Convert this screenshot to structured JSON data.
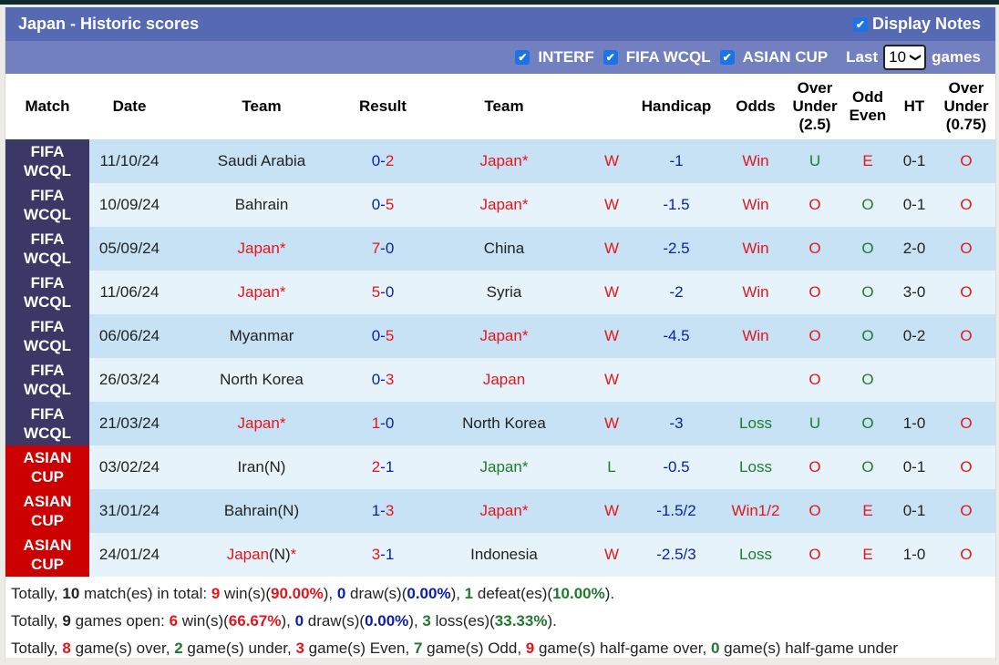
{
  "header": {
    "title": "Japan - Historic scores",
    "display_notes_label": "Display Notes",
    "display_notes_checked": true
  },
  "filters": {
    "items": [
      {
        "label": "INTERF",
        "checked": true
      },
      {
        "label": "FIFA WCQL",
        "checked": true
      },
      {
        "label": "ASIAN CUP",
        "checked": true
      }
    ],
    "last_label": "Last",
    "games_select_value": "10",
    "games_label": "games"
  },
  "columns": [
    "Match",
    "Date",
    "Team",
    "Result",
    "Team",
    "",
    "Handicap",
    "Odds",
    "Over Under (2.5)",
    "Odd Even",
    "HT",
    "Over Under (0.75)"
  ],
  "column_lines": {
    "ou25": [
      "Over",
      "Under",
      "(2.5)"
    ],
    "oe": [
      "Odd",
      "Even"
    ],
    "ou075": [
      "Over",
      "Under",
      "(0.75)"
    ]
  },
  "colors": {
    "title_bar": "#5669b3",
    "filter_bar": "#7380c0",
    "wcql_badge": "#3b3766",
    "asian_badge": "#cc0000",
    "row_dark": "#c7e2f5",
    "row_light": "#e6f3fb",
    "red": "#e8141b",
    "blue": "#0a1fa6",
    "green": "#1f7a2e"
  },
  "rows": [
    {
      "match": [
        "FIFA",
        "WCQL"
      ],
      "type": "wcql",
      "date": "11/10/24",
      "home": "Saudi Arabia",
      "home_color": "black",
      "home_suffix": "",
      "home_star": "",
      "hs": "0",
      "hs_color": "blue",
      "as": "2",
      "as_color": "red",
      "away": "Japan",
      "away_color": "red",
      "away_suffix": "",
      "away_star": "*",
      "wl": "W",
      "wl_color": "red",
      "handicap": "-1",
      "odds": "Win",
      "odds_color": "red",
      "ou": "U",
      "ou_color": "green",
      "oe": "E",
      "oe_color": "red",
      "ht": "0-1",
      "ou075": "O",
      "ou075_color": "red"
    },
    {
      "match": [
        "FIFA",
        "WCQL"
      ],
      "type": "wcql",
      "date": "10/09/24",
      "home": "Bahrain",
      "home_color": "black",
      "home_suffix": "",
      "home_star": "",
      "hs": "0",
      "hs_color": "blue",
      "as": "5",
      "as_color": "red",
      "away": "Japan",
      "away_color": "red",
      "away_suffix": "",
      "away_star": "*",
      "wl": "W",
      "wl_color": "red",
      "handicap": "-1.5",
      "odds": "Win",
      "odds_color": "red",
      "ou": "O",
      "ou_color": "red",
      "oe": "O",
      "oe_color": "green",
      "ht": "0-1",
      "ou075": "O",
      "ou075_color": "red"
    },
    {
      "match": [
        "FIFA",
        "WCQL"
      ],
      "type": "wcql",
      "date": "05/09/24",
      "home": "Japan",
      "home_color": "red",
      "home_suffix": "",
      "home_star": "*",
      "hs": "7",
      "hs_color": "red",
      "as": "0",
      "as_color": "blue",
      "away": "China",
      "away_color": "black",
      "away_suffix": "",
      "away_star": "",
      "wl": "W",
      "wl_color": "red",
      "handicap": "-2.5",
      "odds": "Win",
      "odds_color": "red",
      "ou": "O",
      "ou_color": "red",
      "oe": "O",
      "oe_color": "green",
      "ht": "2-0",
      "ou075": "O",
      "ou075_color": "red"
    },
    {
      "match": [
        "FIFA",
        "WCQL"
      ],
      "type": "wcql",
      "date": "11/06/24",
      "home": "Japan",
      "home_color": "red",
      "home_suffix": "",
      "home_star": "*",
      "hs": "5",
      "hs_color": "red",
      "as": "0",
      "as_color": "blue",
      "away": "Syria",
      "away_color": "black",
      "away_suffix": "",
      "away_star": "",
      "wl": "W",
      "wl_color": "red",
      "handicap": "-2",
      "odds": "Win",
      "odds_color": "red",
      "ou": "O",
      "ou_color": "red",
      "oe": "O",
      "oe_color": "green",
      "ht": "3-0",
      "ou075": "O",
      "ou075_color": "red"
    },
    {
      "match": [
        "FIFA",
        "WCQL"
      ],
      "type": "wcql",
      "date": "06/06/24",
      "home": "Myanmar",
      "home_color": "black",
      "home_suffix": "",
      "home_star": "",
      "hs": "0",
      "hs_color": "blue",
      "as": "5",
      "as_color": "red",
      "away": "Japan",
      "away_color": "red",
      "away_suffix": "",
      "away_star": "*",
      "wl": "W",
      "wl_color": "red",
      "handicap": "-4.5",
      "odds": "Win",
      "odds_color": "red",
      "ou": "O",
      "ou_color": "red",
      "oe": "O",
      "oe_color": "green",
      "ht": "0-2",
      "ou075": "O",
      "ou075_color": "red"
    },
    {
      "match": [
        "FIFA",
        "WCQL"
      ],
      "type": "wcql",
      "date": "26/03/24",
      "home": "North Korea",
      "home_color": "black",
      "home_suffix": "",
      "home_star": "",
      "hs": "0",
      "hs_color": "blue",
      "as": "3",
      "as_color": "red",
      "away": "Japan",
      "away_color": "red",
      "away_suffix": "",
      "away_star": "",
      "wl": "W",
      "wl_color": "red",
      "handicap": "",
      "odds": "",
      "odds_color": "red",
      "ou": "O",
      "ou_color": "red",
      "oe": "O",
      "oe_color": "green",
      "ht": "",
      "ou075": "",
      "ou075_color": "red"
    },
    {
      "match": [
        "FIFA",
        "WCQL"
      ],
      "type": "wcql",
      "date": "21/03/24",
      "home": "Japan",
      "home_color": "red",
      "home_suffix": "",
      "home_star": "*",
      "hs": "1",
      "hs_color": "red",
      "as": "0",
      "as_color": "blue",
      "away": "North Korea",
      "away_color": "black",
      "away_suffix": "",
      "away_star": "",
      "wl": "W",
      "wl_color": "red",
      "handicap": "-3",
      "odds": "Loss",
      "odds_color": "green",
      "ou": "U",
      "ou_color": "green",
      "oe": "O",
      "oe_color": "green",
      "ht": "1-0",
      "ou075": "O",
      "ou075_color": "red"
    },
    {
      "match": [
        "ASIAN",
        "CUP"
      ],
      "type": "asian",
      "date": "03/02/24",
      "home": "Iran",
      "home_color": "black",
      "home_suffix": "(N)",
      "home_star": "",
      "hs": "2",
      "hs_color": "red",
      "as": "1",
      "as_color": "blue",
      "away": "Japan",
      "away_color": "green",
      "away_suffix": "",
      "away_star": "*",
      "wl": "L",
      "wl_color": "green",
      "handicap": "-0.5",
      "odds": "Loss",
      "odds_color": "green",
      "ou": "O",
      "ou_color": "red",
      "oe": "O",
      "oe_color": "green",
      "ht": "0-1",
      "ou075": "O",
      "ou075_color": "red"
    },
    {
      "match": [
        "ASIAN",
        "CUP"
      ],
      "type": "asian",
      "date": "31/01/24",
      "home": "Bahrain",
      "home_color": "black",
      "home_suffix": "(N)",
      "home_star": "",
      "hs": "1",
      "hs_color": "blue",
      "as": "3",
      "as_color": "red",
      "away": "Japan",
      "away_color": "red",
      "away_suffix": "",
      "away_star": "*",
      "wl": "W",
      "wl_color": "red",
      "handicap": "-1.5/2",
      "odds": "Win1/2",
      "odds_color": "red",
      "ou": "O",
      "ou_color": "red",
      "oe": "E",
      "oe_color": "red",
      "ht": "0-1",
      "ou075": "O",
      "ou075_color": "red"
    },
    {
      "match": [
        "ASIAN",
        "CUP"
      ],
      "type": "asian",
      "date": "24/01/24",
      "home": "Japan",
      "home_color": "red",
      "home_suffix": "(N)",
      "home_star": "*",
      "hs": "3",
      "hs_color": "red",
      "as": "1",
      "as_color": "blue",
      "away": "Indonesia",
      "away_color": "black",
      "away_suffix": "",
      "away_star": "",
      "wl": "W",
      "wl_color": "red",
      "handicap": "-2.5/3",
      "odds": "Loss",
      "odds_color": "green",
      "ou": "O",
      "ou_color": "red",
      "oe": "E",
      "oe_color": "red",
      "ht": "1-0",
      "ou075": "O",
      "ou075_color": "red"
    }
  ],
  "summary": {
    "line1": [
      {
        "t": "Totally, "
      },
      {
        "t": "10",
        "c": "black",
        "b": true
      },
      {
        "t": " match(es) in total: "
      },
      {
        "t": "9",
        "c": "red",
        "b": true
      },
      {
        "t": " win(s)("
      },
      {
        "t": "90.00%",
        "c": "red",
        "b": true
      },
      {
        "t": "), "
      },
      {
        "t": "0",
        "c": "blue",
        "b": true
      },
      {
        "t": " draw(s)("
      },
      {
        "t": "0.00%",
        "c": "blue",
        "b": true
      },
      {
        "t": "), "
      },
      {
        "t": "1",
        "c": "green",
        "b": true
      },
      {
        "t": " defeat(es)("
      },
      {
        "t": "10.00%",
        "c": "green",
        "b": true
      },
      {
        "t": ")."
      }
    ],
    "line2": [
      {
        "t": "Totally, "
      },
      {
        "t": "9",
        "c": "black",
        "b": true
      },
      {
        "t": " games open: "
      },
      {
        "t": "6",
        "c": "red",
        "b": true
      },
      {
        "t": " win(s)("
      },
      {
        "t": "66.67%",
        "c": "red",
        "b": true
      },
      {
        "t": "), "
      },
      {
        "t": "0",
        "c": "blue",
        "b": true
      },
      {
        "t": " draw(s)("
      },
      {
        "t": "0.00%",
        "c": "blue",
        "b": true
      },
      {
        "t": "), "
      },
      {
        "t": "3",
        "c": "green",
        "b": true
      },
      {
        "t": " loss(es)("
      },
      {
        "t": "33.33%",
        "c": "green",
        "b": true
      },
      {
        "t": ")."
      }
    ],
    "line3": [
      {
        "t": "Totally, "
      },
      {
        "t": "8",
        "c": "red",
        "b": true
      },
      {
        "t": " game(s) over, "
      },
      {
        "t": "2",
        "c": "green",
        "b": true
      },
      {
        "t": " game(s) under, "
      },
      {
        "t": "3",
        "c": "red",
        "b": true
      },
      {
        "t": " game(s) Even, "
      },
      {
        "t": "7",
        "c": "green",
        "b": true
      },
      {
        "t": " game(s) Odd, "
      },
      {
        "t": "9",
        "c": "red",
        "b": true
      },
      {
        "t": " game(s) half-game over, "
      },
      {
        "t": "0",
        "c": "green",
        "b": true
      },
      {
        "t": " game(s) half-game under"
      }
    ]
  }
}
